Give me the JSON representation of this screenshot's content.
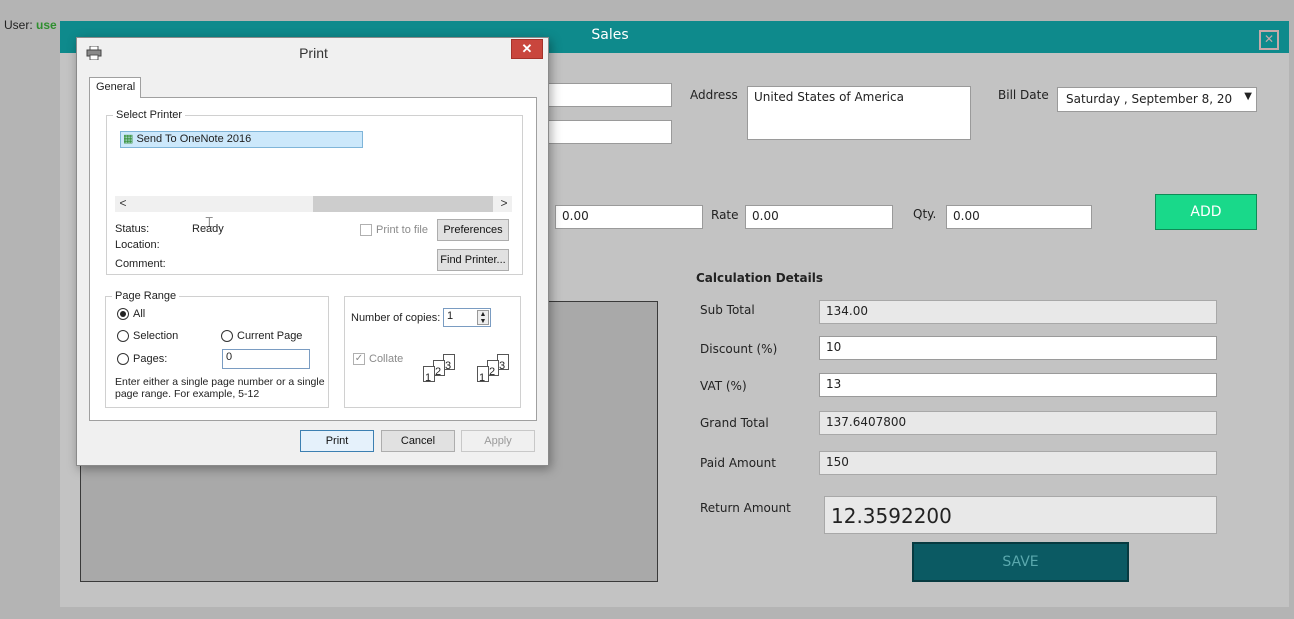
{
  "user": {
    "label": "User:",
    "value": "use"
  },
  "sales": {
    "title": "Sales",
    "close_glyph": "✕",
    "address_label": "Address",
    "address_value": "United States of America",
    "bill_date_label": "Bill Date",
    "bill_date_value": "Saturday  , September  8, 20",
    "rate_label": "Rate",
    "rate_value": "0.00",
    "qty_label": "Qty.",
    "qty_value": "0.00",
    "amount_value": "0.00",
    "add_label": "ADD",
    "calc_heading": "Calculation Details",
    "sub_total_label": "Sub Total",
    "sub_total_value": "134.00",
    "discount_label": "Discount (%)",
    "discount_value": "10",
    "vat_label": "VAT (%)",
    "vat_value": "13",
    "grand_total_label": "Grand Total",
    "grand_total_value": "137.6407800",
    "paid_label": "Paid Amount",
    "paid_value": "150",
    "return_label": "Return Amount",
    "return_value": "12.3592200",
    "save_label": "SAVE"
  },
  "print_dialog": {
    "title": "Print",
    "close_glyph": "✕",
    "tab_general": "General",
    "select_printer_label": "Select Printer",
    "printer_name": "Send To OneNote 2016",
    "scroll_left": "<",
    "scroll_right": ">",
    "status_label": "Status:",
    "status_value": "Ready",
    "location_label": "Location:",
    "comment_label": "Comment:",
    "print_to_file_label": "Print to file",
    "preferences_label": "Preferences",
    "find_printer_label": "Find Printer...",
    "page_range_label": "Page Range",
    "all_label": "All",
    "selection_label": "Selection",
    "current_page_label": "Current Page",
    "pages_label": "Pages:",
    "pages_value": "0",
    "hint_line1": "Enter either a single page number or a single",
    "hint_line2": "page range.  For example, 5-12",
    "copies_label": "Number of copies:",
    "copies_value": "1",
    "collate_label": "Collate",
    "page_num_1": "1",
    "page_num_2": "2",
    "page_num_3": "3",
    "print_button": "Print",
    "cancel_button": "Cancel",
    "apply_button": "Apply",
    "page_range_selected": "All"
  },
  "colors": {
    "title_bar": "#0e8a8c",
    "add_button": "#19d98a",
    "save_button": "#0b5a63",
    "dialog_close": "#c9463d"
  }
}
